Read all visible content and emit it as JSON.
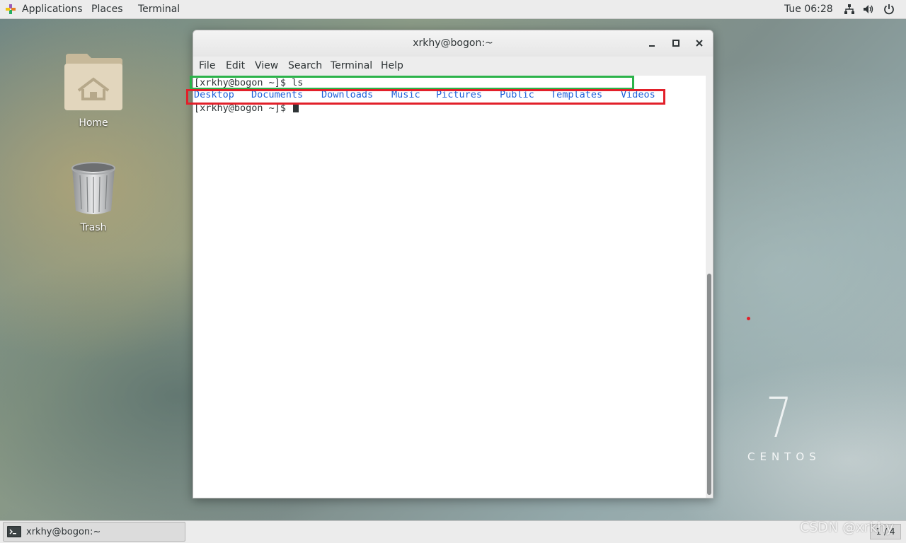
{
  "top_panel": {
    "menus": [
      "Applications",
      "Places",
      "Terminal"
    ],
    "clock": "Tue 06:28",
    "tray_icons": [
      "network-icon",
      "volume-icon",
      "power-icon"
    ]
  },
  "desktop": {
    "icons": [
      {
        "label": "Home",
        "icon": "home-folder-icon"
      },
      {
        "label": "Trash",
        "icon": "trash-icon"
      }
    ]
  },
  "window": {
    "title": "xrkhy@bogon:~",
    "controls": [
      "minimize",
      "maximize",
      "close"
    ],
    "menu": [
      "File",
      "Edit",
      "View",
      "Search",
      "Terminal",
      "Help"
    ]
  },
  "terminal": {
    "line1": "[xrkhy@bogon ~]$ ls",
    "ls_output": [
      "Desktop",
      "Documents",
      "Downloads",
      "Music",
      "Pictures",
      "Public",
      "Templates",
      "Videos"
    ],
    "line3": "[xrkhy@bogon ~]$ "
  },
  "annotations": {
    "box_colors": {
      "command": "#2bb34a",
      "output": "#e2202a"
    }
  },
  "watermark": {
    "number": "7",
    "brand": "CENTOS",
    "csdn": "CSDN @xrkhy"
  },
  "taskbar": {
    "task_label": "xrkhy@bogon:~",
    "workspace": "1 / 4"
  }
}
